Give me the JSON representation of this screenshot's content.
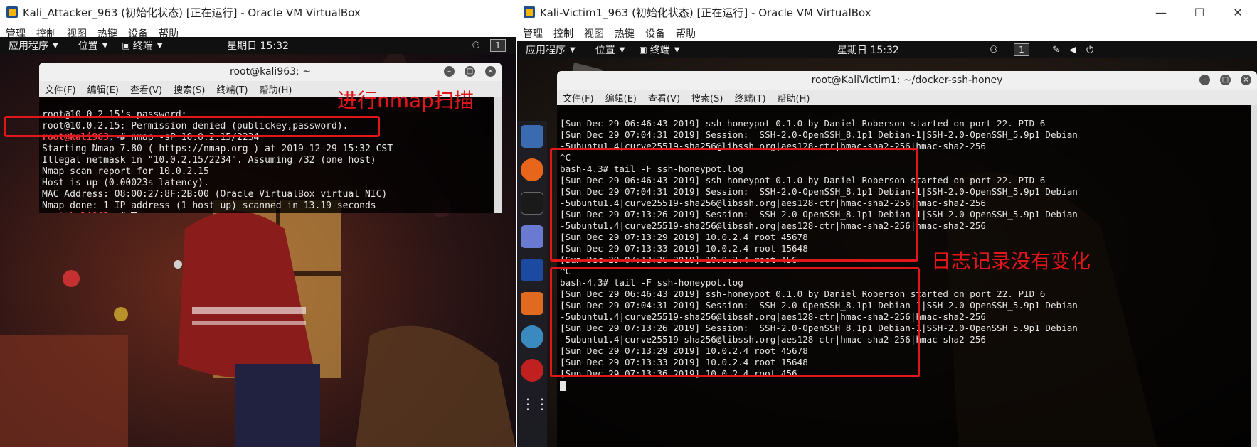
{
  "left_window": {
    "title": "Kali_Attacker_963 (初始化状态) [正在运行] - Oracle VM VirtualBox",
    "menu": [
      "管理",
      "控制",
      "视图",
      "热键",
      "设备",
      "帮助"
    ],
    "topbar": {
      "apps": "应用程序",
      "places": "位置",
      "terminal": "终端",
      "clock": "星期日 15:32",
      "workspace": "1"
    },
    "terminal": {
      "title": "root@kali963: ~",
      "menu": [
        "文件(F)",
        "编辑(E)",
        "查看(V)",
        "搜索(S)",
        "终端(T)",
        "帮助(H)"
      ],
      "lines": [
        "root@10.0.2.15's password:",
        "root@10.0.2.15: Permission denied (publickey,password).",
        "",
        "Starting Nmap 7.80 ( https://nmap.org ) at 2019-12-29 15:32 CST",
        "Illegal netmask in \"10.0.2.15/2234\". Assuming /32 (one host)",
        "Nmap scan report for 10.0.2.15",
        "Host is up (0.00023s latency).",
        "MAC Address: 08:00:27:8F:2B:00 (Oracle VirtualBox virtual NIC)",
        "Nmap done: 1 IP address (1 host up) scanned in 13.19 seconds"
      ],
      "prompt_user": "root@kali963",
      "prompt_path": ":~",
      "prompt_symbol": "# ",
      "command": "nmap -sP 10.0.2.15/2234"
    },
    "annotation": "进行nmap扫描"
  },
  "right_window": {
    "title": "Kali-Victim1_963 (初始化状态) [正在运行] - Oracle VM VirtualBox",
    "window_controls": [
      "—",
      "☐",
      "✕"
    ],
    "menu": [
      "管理",
      "控制",
      "视图",
      "热键",
      "设备",
      "帮助"
    ],
    "topbar": {
      "apps": "应用程序",
      "places": "位置",
      "terminal": "终端",
      "clock": "星期日 15:32",
      "workspace": "1"
    },
    "terminal": {
      "title": "root@KaliVictim1: ~/docker-ssh-honey",
      "menu": [
        "文件(F)",
        "编辑(E)",
        "查看(V)",
        "搜索(S)",
        "终端(T)",
        "帮助(H)"
      ],
      "lines": [
        "[Sun Dec 29 06:46:43 2019] ssh-honeypot 0.1.0 by Daniel Roberson started on port 22. PID 6",
        "[Sun Dec 29 07:04:31 2019] Session:  SSH-2.0-OpenSSH_8.1p1 Debian-1|SSH-2.0-OpenSSH_5.9p1 Debian",
        "-5ubuntu1.4|curve25519-sha256@libssh.org|aes128-ctr|hmac-sha2-256|hmac-sha2-256",
        "^C",
        "bash-4.3# tail -F ssh-honeypot.log",
        "[Sun Dec 29 06:46:43 2019] ssh-honeypot 0.1.0 by Daniel Roberson started on port 22. PID 6",
        "[Sun Dec 29 07:04:31 2019] Session:  SSH-2.0-OpenSSH_8.1p1 Debian-1|SSH-2.0-OpenSSH_5.9p1 Debian",
        "-5ubuntu1.4|curve25519-sha256@libssh.org|aes128-ctr|hmac-sha2-256|hmac-sha2-256",
        "[Sun Dec 29 07:13:26 2019] Session:  SSH-2.0-OpenSSH_8.1p1 Debian-1|SSH-2.0-OpenSSH_5.9p1 Debian",
        "-5ubuntu1.4|curve25519-sha256@libssh.org|aes128-ctr|hmac-sha2-256|hmac-sha2-256",
        "[Sun Dec 29 07:13:29 2019] 10.0.2.4 root 45678",
        "[Sun Dec 29 07:13:33 2019] 10.0.2.4 root 15648",
        "[Sun Dec 29 07:13:36 2019] 10.0.2.4 root 456",
        "^C",
        "bash-4.3# tail -F ssh-honeypot.log",
        "[Sun Dec 29 06:46:43 2019] ssh-honeypot 0.1.0 by Daniel Roberson started on port 22. PID 6",
        "[Sun Dec 29 07:04:31 2019] Session:  SSH-2.0-OpenSSH_8.1p1 Debian-1|SSH-2.0-OpenSSH_5.9p1 Debian",
        "-5ubuntu1.4|curve25519-sha256@libssh.org|aes128-ctr|hmac-sha2-256|hmac-sha2-256",
        "[Sun Dec 29 07:13:26 2019] Session:  SSH-2.0-OpenSSH_8.1p1 Debian-1|SSH-2.0-OpenSSH_5.9p1 Debian",
        "-5ubuntu1.4|curve25519-sha256@libssh.org|aes128-ctr|hmac-sha2-256|hmac-sha2-256",
        "[Sun Dec 29 07:13:29 2019] 10.0.2.4 root 45678",
        "[Sun Dec 29 07:13:33 2019] 10.0.2.4 root 15648",
        "[Sun Dec 29 07:13:36 2019] 10.0.2.4 root 456"
      ]
    },
    "annotation": "日志记录没有变化"
  },
  "colors": {
    "annotation_red": "#e0161b",
    "prompt_red": "#ff4444",
    "prompt_blue": "#6ea6ff"
  }
}
